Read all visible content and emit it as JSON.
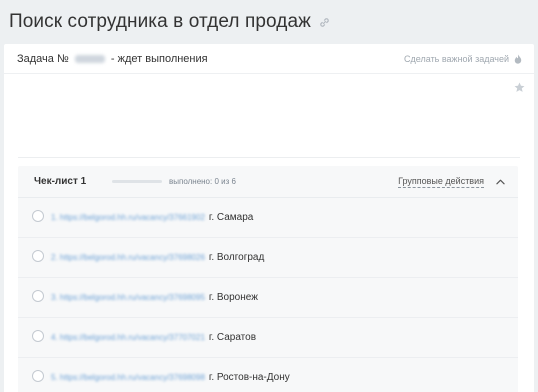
{
  "page": {
    "title": "Поиск сотрудника в отдел продаж"
  },
  "task": {
    "number_label": "Задача №",
    "number_value": "171872",
    "status_text": "- ждет выполнения",
    "important_action_label": "Сделать важной задачей"
  },
  "checklist": {
    "title": "Чек-лист 1",
    "progress_text": "выполнено: 0 из 6",
    "progress_fraction": 0,
    "group_actions_label": "Групповые действия",
    "items": [
      {
        "link": "1. https://belgorod.hh.ru/vacancy/37661902",
        "city": "г. Самара"
      },
      {
        "link": "2. https://belgorod.hh.ru/vacancy/37698026",
        "city": "г. Волгоград"
      },
      {
        "link": "3. https://belgorod.hh.ru/vacancy/37698095",
        "city": "г. Воронеж"
      },
      {
        "link": "4. https://belgorod.hh.ru/vacancy/37707021",
        "city": "г. Саратов"
      },
      {
        "link": "5. https://belgorod.hh.ru/vacancy/37698098",
        "city": "г. Ростов-на-Дону"
      }
    ]
  },
  "colors": {
    "background": "#edf0f2",
    "card": "#ffffff",
    "link": "#6fa3d6",
    "muted_text": "#a0a8b0"
  },
  "icons": {
    "title_link": "link-icon",
    "important": "flame-icon",
    "favorite": "star-icon",
    "collapse": "chevron-up-icon"
  }
}
